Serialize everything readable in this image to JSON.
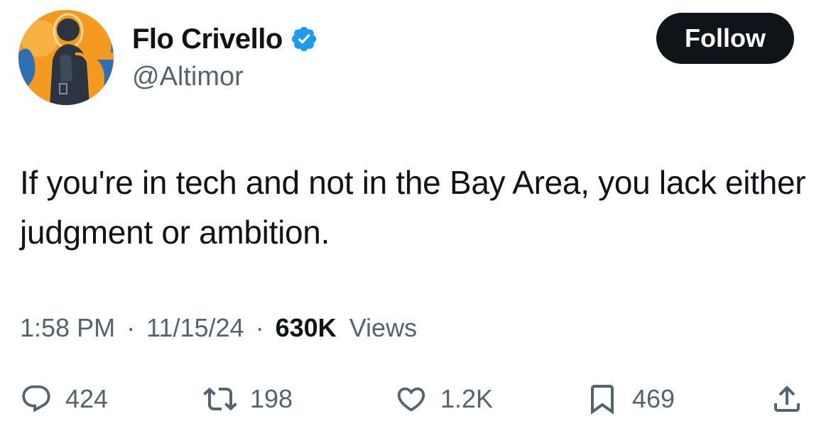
{
  "author": {
    "display_name": "Flo Crivello",
    "handle": "@Altimor",
    "verified": true,
    "verified_icon": "verified-badge-icon",
    "verified_color": "#1d9bf0"
  },
  "follow_button": {
    "label": "Follow"
  },
  "tweet": {
    "text": "If you're in tech and not in the Bay Area, you lack either judgment or ambition."
  },
  "meta": {
    "time": "1:58 PM",
    "separator": "·",
    "date": "11/15/24",
    "views_count": "630K",
    "views_label": "Views"
  },
  "actions": {
    "reply": {
      "icon": "reply-icon",
      "count": "424"
    },
    "retweet": {
      "icon": "retweet-icon",
      "count": "198"
    },
    "like": {
      "icon": "heart-icon",
      "count": "1.2K"
    },
    "bookmark": {
      "icon": "bookmark-icon",
      "count": "469"
    },
    "share": {
      "icon": "share-icon"
    }
  },
  "colors": {
    "text_primary": "#0f1419",
    "text_secondary": "#536471",
    "button_bg": "#0f1419",
    "avatar_orange": "#f39a1f",
    "avatar_blue": "#2f6fb5"
  }
}
